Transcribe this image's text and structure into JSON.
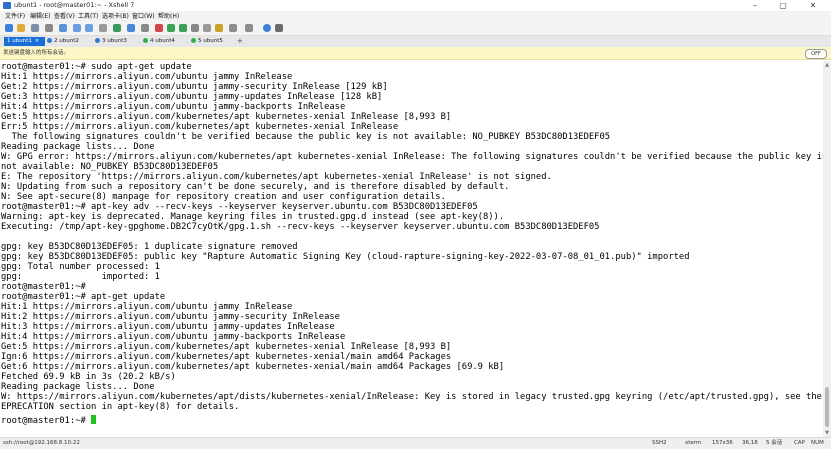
{
  "window": {
    "title": "ubunt1 - root@master01:~ - Xshell 7"
  },
  "window_controls": [
    "–",
    "▢",
    "✕"
  ],
  "menu": [
    "文件(F)",
    "编辑(E)",
    "查看(V)",
    "工具(T)",
    "选项卡(B)",
    "窗口(W)",
    "帮助(H)"
  ],
  "tabs": [
    {
      "label": "1 ubunt1",
      "active": true,
      "color": "#ffffff"
    },
    {
      "label": "2 ubunt2",
      "active": false,
      "color": "#2a7ad6"
    },
    {
      "label": "3 ubunt3",
      "active": false,
      "color": "#2a7ad6"
    },
    {
      "label": "4 ubunt4",
      "active": false,
      "color": "#2bb34a"
    },
    {
      "label": "5 ubunt5",
      "active": false,
      "color": "#2bb34a"
    }
  ],
  "add_tab": "+",
  "sendbar": {
    "text": "发送键盘输入的所有会话。",
    "toggle": "OFF"
  },
  "terminal_lines": [
    "root@master01:~# sudo apt-get update",
    "Hit:1 https://mirrors.aliyun.com/ubuntu jammy InRelease",
    "Get:2 https://mirrors.aliyun.com/ubuntu jammy-security InRelease [129 kB]",
    "Get:3 https://mirrors.aliyun.com/ubuntu jammy-updates InRelease [128 kB]",
    "Hit:4 https://mirrors.aliyun.com/ubuntu jammy-backports InRelease",
    "Get:5 https://mirrors.aliyun.com/kubernetes/apt kubernetes-xenial InRelease [8,993 B]",
    "Err:5 https://mirrors.aliyun.com/kubernetes/apt kubernetes-xenial InRelease",
    "  The following signatures couldn't be verified because the public key is not available: NO_PUBKEY B53DC80D13EDEF05",
    "Reading package lists... Done",
    "W: GPG error: https://mirrors.aliyun.com/kubernetes/apt kubernetes-xenial InRelease: The following signatures couldn't be verified because the public key is",
    "not available: NO_PUBKEY B53DC80D13EDEF05",
    "E: The repository 'https://mirrors.aliyun.com/kubernetes/apt kubernetes-xenial InRelease' is not signed.",
    "N: Updating from such a repository can't be done securely, and is therefore disabled by default.",
    "N: See apt-secure(8) manpage for repository creation and user configuration details.",
    "root@master01:~# apt-key adv --recv-keys --keyserver keyserver.ubuntu.com B53DC80D13EDEF05",
    "Warning: apt-key is deprecated. Manage keyring files in trusted.gpg.d instead (see apt-key(8)).",
    "Executing: /tmp/apt-key-gpghome.DB2C7cyOtK/gpg.1.sh --recv-keys --keyserver keyserver.ubuntu.com B53DC80D13EDEF05",
    "",
    "gpg: key B53DC80D13EDEF05: 1 duplicate signature removed",
    "gpg: key B53DC80D13EDEF05: public key \"Rapture Automatic Signing Key (cloud-rapture-signing-key-2022-03-07-08_01_01.pub)\" imported",
    "gpg: Total number processed: 1",
    "gpg:               imported: 1",
    "root@master01:~#",
    "root@master01:~# apt-get update",
    "Hit:1 https://mirrors.aliyun.com/ubuntu jammy InRelease",
    "Hit:2 https://mirrors.aliyun.com/ubuntu jammy-security InRelease",
    "Hit:3 https://mirrors.aliyun.com/ubuntu jammy-updates InRelease",
    "Hit:4 https://mirrors.aliyun.com/ubuntu jammy-backports InRelease",
    "Get:5 https://mirrors.aliyun.com/kubernetes/apt kubernetes-xenial InRelease [8,993 B]",
    "Ign:6 https://mirrors.aliyun.com/kubernetes/apt kubernetes-xenial/main amd64 Packages",
    "Get:6 https://mirrors.aliyun.com/kubernetes/apt kubernetes-xenial/main amd64 Packages [69.9 kB]",
    "Fetched 69.9 kB in 3s (20.2 kB/s)",
    "Reading package lists... Done",
    "W: https://mirrors.aliyun.com/kubernetes/apt/dists/kubernetes-xenial/InRelease: Key is stored in legacy trusted.gpg keyring (/etc/apt/trusted.gpg), see the D",
    "EPRECATION section in apt-key(8) for details."
  ],
  "prompt": "root@master01:~# ",
  "colors": {
    "cursor": "#22c21b",
    "active_tab": "#1a6fd6",
    "sendbar_bg": "#fdf6c6"
  },
  "statusbar": {
    "connection": "ssh://root@192.168.8.10:22",
    "protocol": "SSH2",
    "terminal": "xterm",
    "size": "157x36",
    "position": "36,18",
    "sessions": "5 会话",
    "caps": "CAP",
    "num": "NUM"
  }
}
